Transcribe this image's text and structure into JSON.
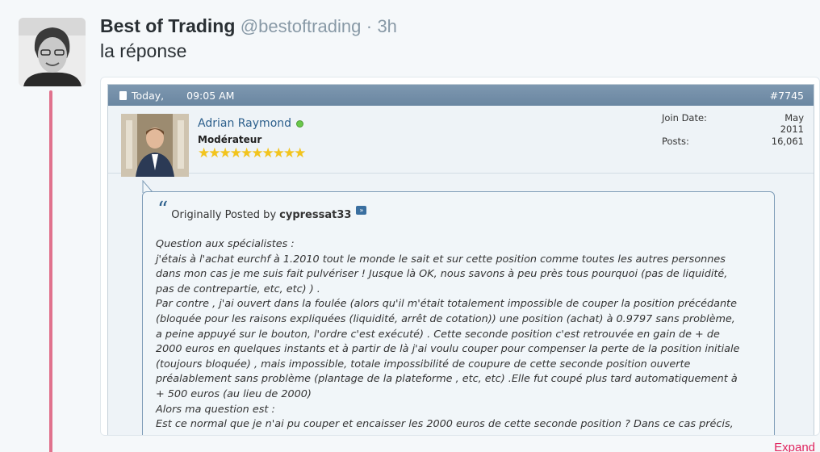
{
  "tweet": {
    "name": "Best of Trading",
    "handle": "@bestoftrading",
    "separator": "·",
    "time": "3h",
    "text": "la réponse",
    "expand_label": "Expand"
  },
  "forum_post": {
    "date_label": "Today,",
    "time": "09:05 AM",
    "post_number": "#7745",
    "username": "Adrian Raymond",
    "user_title": "Modérateur",
    "stars": "★★★★★★★★★★",
    "stats": [
      {
        "label": "Join Date:",
        "value": "May 2011"
      },
      {
        "label": "Posts:",
        "value": "16,061"
      }
    ],
    "quote": {
      "intro": "Originally Posted by",
      "author": "cypressat33",
      "lines": [
        "Question aux spécialistes :",
        "j'étais à l'achat eurchf à 1.2010 tout le monde le sait et sur cette position comme toutes les autres personnes",
        "dans mon cas je me suis fait pulvériser ! Jusque là OK, nous savons à peu près tous pourquoi (pas de liquidité,",
        "pas de contrepartie, etc, etc) ) .",
        "Par contre , j'ai ouvert dans la foulée (alors qu'il m'était totalement impossible de couper la position précédante",
        "(bloquée pour les raisons expliquées (liquidité, arrêt de cotation)) une position (achat) à 0.9797 sans problème,",
        "a peine appuyé sur le bouton, l'ordre c'est exécuté) . Cette seconde position c'est retrouvée en gain de + de",
        "2000 euros en quelques instants et à partir de là j'ai voulu couper pour compenser la perte de la position initiale",
        "(toujours bloquée) , mais impossible, totale impossibilité de coupure de cette seconde position ouverte",
        "préalablement sans problème (plantage de la plateforme , etc, etc) .Elle fut coupé plus tard automatiquement à",
        "+ 500 euros (au lieu de 2000)",
        "Alors ma question est :",
        "Est ce normal que je n'ai pu couper et encaisser les 2000 euros de cette seconde position ? Dans ce cas précis,"
      ]
    }
  },
  "colors": {
    "thread_line": "#e0728d",
    "name_link": "#2c5f8c",
    "expand": "#e0245e",
    "online": "#6ac84b"
  },
  "icons": [
    "document-icon",
    "online-status-icon",
    "quote-icon",
    "view-post-icon",
    "star-rating"
  ]
}
